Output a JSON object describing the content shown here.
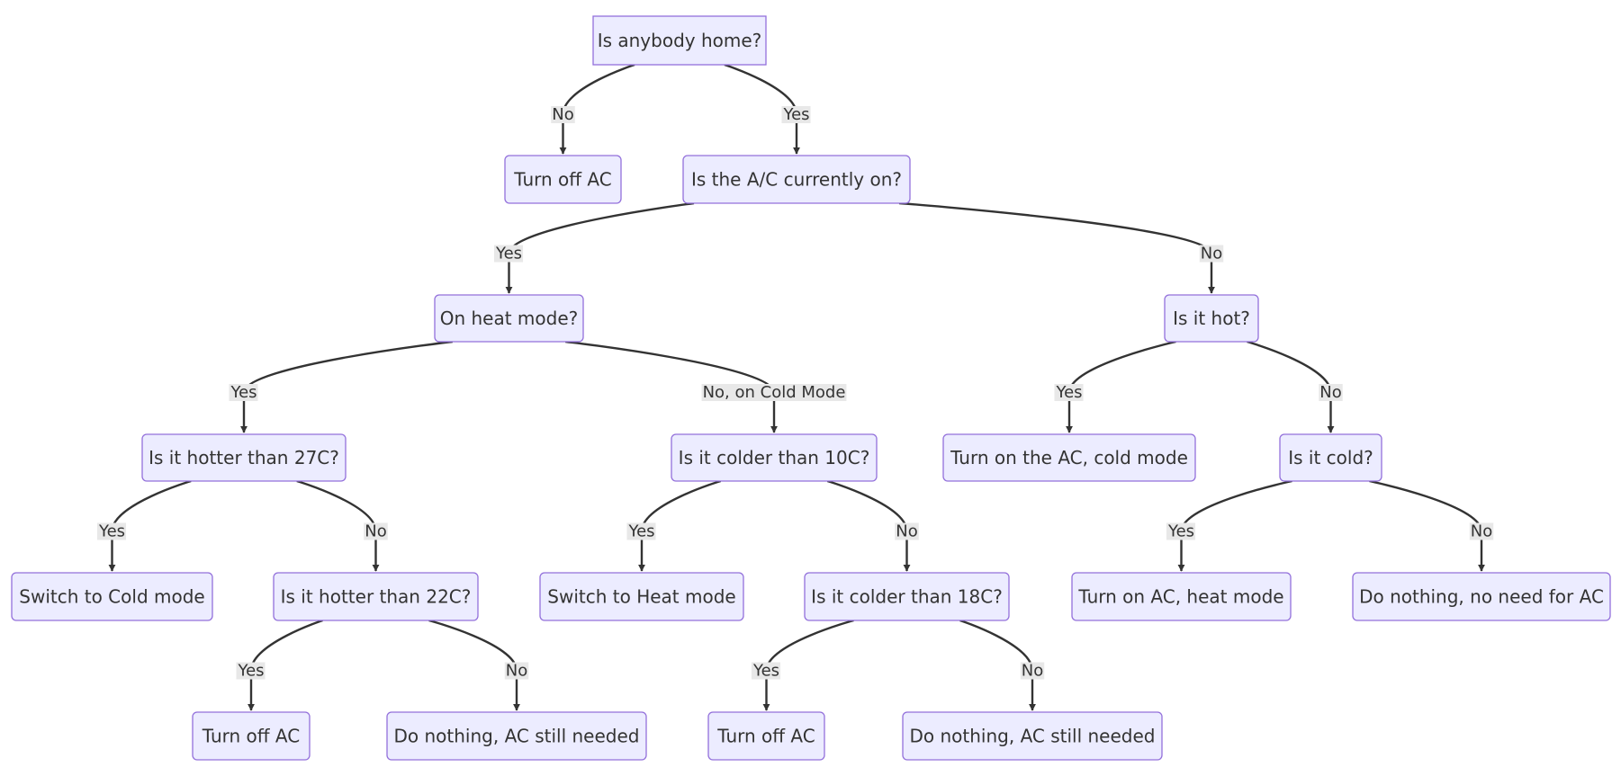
{
  "diagram": {
    "type": "flowchart",
    "direction": "top-down",
    "colors": {
      "node_fill": "#ECECFF",
      "node_border": "#9370DB",
      "edge": "#333333",
      "text": "#333333",
      "label_bg": "#e8e8e8"
    },
    "nodes": [
      {
        "id": "anybody_home",
        "label": "Is anybody home?",
        "shape": "rect"
      },
      {
        "id": "turn_off_1",
        "label": "Turn off AC",
        "shape": "round"
      },
      {
        "id": "ac_on",
        "label": "Is the A/C currently on?",
        "shape": "round"
      },
      {
        "id": "heat_mode",
        "label": "On heat mode?",
        "shape": "round"
      },
      {
        "id": "is_hot",
        "label": "Is it hot?",
        "shape": "round"
      },
      {
        "id": "hotter_27",
        "label": "Is it hotter than 27C?",
        "shape": "round"
      },
      {
        "id": "colder_10",
        "label": "Is it colder than 10C?",
        "shape": "round"
      },
      {
        "id": "turn_on_cold",
        "label": "Turn on the AC, cold mode",
        "shape": "round"
      },
      {
        "id": "is_cold",
        "label": "Is it cold?",
        "shape": "round"
      },
      {
        "id": "switch_cold",
        "label": "Switch to Cold mode",
        "shape": "round"
      },
      {
        "id": "hotter_22",
        "label": "Is it hotter than 22C?",
        "shape": "round"
      },
      {
        "id": "switch_heat",
        "label": "Switch to Heat mode",
        "shape": "round"
      },
      {
        "id": "colder_18",
        "label": "Is it colder than 18C?",
        "shape": "round"
      },
      {
        "id": "turn_on_heat",
        "label": "Turn on AC, heat mode",
        "shape": "round"
      },
      {
        "id": "nothing_no_need",
        "label": "Do nothing, no need for AC",
        "shape": "round"
      },
      {
        "id": "turn_off_2",
        "label": "Turn off AC",
        "shape": "round"
      },
      {
        "id": "nothing_needed_1",
        "label": "Do nothing, AC still needed",
        "shape": "round"
      },
      {
        "id": "turn_off_3",
        "label": "Turn off AC",
        "shape": "round"
      },
      {
        "id": "nothing_needed_2",
        "label": "Do nothing, AC still needed",
        "shape": "round"
      }
    ],
    "edges": [
      {
        "from": "anybody_home",
        "to": "turn_off_1",
        "label": "No"
      },
      {
        "from": "anybody_home",
        "to": "ac_on",
        "label": "Yes"
      },
      {
        "from": "ac_on",
        "to": "heat_mode",
        "label": "Yes"
      },
      {
        "from": "ac_on",
        "to": "is_hot",
        "label": "No"
      },
      {
        "from": "heat_mode",
        "to": "hotter_27",
        "label": "Yes"
      },
      {
        "from": "heat_mode",
        "to": "colder_10",
        "label": "No, on Cold Mode"
      },
      {
        "from": "is_hot",
        "to": "turn_on_cold",
        "label": "Yes"
      },
      {
        "from": "is_hot",
        "to": "is_cold",
        "label": "No"
      },
      {
        "from": "hotter_27",
        "to": "switch_cold",
        "label": "Yes"
      },
      {
        "from": "hotter_27",
        "to": "hotter_22",
        "label": "No"
      },
      {
        "from": "colder_10",
        "to": "switch_heat",
        "label": "Yes"
      },
      {
        "from": "colder_10",
        "to": "colder_18",
        "label": "No"
      },
      {
        "from": "is_cold",
        "to": "turn_on_heat",
        "label": "Yes"
      },
      {
        "from": "is_cold",
        "to": "nothing_no_need",
        "label": "No"
      },
      {
        "from": "hotter_22",
        "to": "turn_off_2",
        "label": "Yes"
      },
      {
        "from": "hotter_22",
        "to": "nothing_needed_1",
        "label": "No"
      },
      {
        "from": "colder_18",
        "to": "turn_off_3",
        "label": "Yes"
      },
      {
        "from": "colder_18",
        "to": "nothing_needed_2",
        "label": "No"
      }
    ]
  }
}
